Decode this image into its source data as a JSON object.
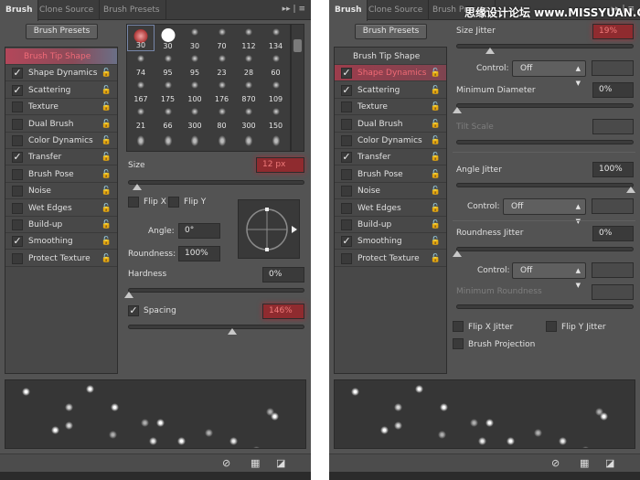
{
  "tabs": [
    "Brush",
    "Clone Source",
    "Brush Presets"
  ],
  "brush_presets_button": "Brush Presets",
  "watermark": "思缘设计论坛 www.MISSYUAN.COM",
  "left_panel": {
    "list": [
      {
        "label": "Brush Tip Shape",
        "checked": null,
        "highlight": true
      },
      {
        "label": "Shape Dynamics",
        "checked": true
      },
      {
        "label": "Scattering",
        "checked": true
      },
      {
        "label": "Texture",
        "checked": false
      },
      {
        "label": "Dual Brush",
        "checked": false
      },
      {
        "label": "Color Dynamics",
        "checked": false
      },
      {
        "label": "Transfer",
        "checked": true
      },
      {
        "label": "Brush Pose",
        "checked": false
      },
      {
        "label": "Noise",
        "checked": false
      },
      {
        "label": "Wet Edges",
        "checked": false
      },
      {
        "label": "Build-up",
        "checked": false
      },
      {
        "label": "Smoothing",
        "checked": true
      },
      {
        "label": "Protect Texture",
        "checked": false
      }
    ],
    "brush_sizes": [
      "30",
      "30",
      "30",
      "70",
      "112",
      "134",
      "74",
      "95",
      "95",
      "23",
      "28",
      "60",
      "167",
      "175",
      "100",
      "176",
      "870",
      "109",
      "21",
      "66",
      "300",
      "80",
      "300",
      "150"
    ],
    "size_label": "Size",
    "size_value": "12 px",
    "size_slider": 0.05,
    "flip_x": "Flip X",
    "flip_y": "Flip Y",
    "angle_label": "Angle:",
    "angle_value": "0°",
    "roundness_label": "Roundness:",
    "roundness_value": "100%",
    "hardness_label": "Hardness",
    "hardness_value": "0%",
    "hardness_slider": 0,
    "spacing_label": "Spacing",
    "spacing_checked": true,
    "spacing_value": "146%",
    "spacing_slider": 0.6
  },
  "right_panel": {
    "list": [
      {
        "label": "Brush Tip Shape",
        "checked": null
      },
      {
        "label": "Shape Dynamics",
        "checked": true,
        "highlight": true
      },
      {
        "label": "Scattering",
        "checked": true
      },
      {
        "label": "Texture",
        "checked": false
      },
      {
        "label": "Dual Brush",
        "checked": false
      },
      {
        "label": "Color Dynamics",
        "checked": false
      },
      {
        "label": "Transfer",
        "checked": true
      },
      {
        "label": "Brush Pose",
        "checked": false
      },
      {
        "label": "Noise",
        "checked": false
      },
      {
        "label": "Wet Edges",
        "checked": false
      },
      {
        "label": "Build-up",
        "checked": false
      },
      {
        "label": "Smoothing",
        "checked": true
      },
      {
        "label": "Protect Texture",
        "checked": false
      }
    ],
    "size_jitter_label": "Size Jitter",
    "size_jitter_value": "19%",
    "size_jitter_slider": 0.19,
    "control_label": "Control:",
    "control1_value": "Off",
    "min_diameter_label": "Minimum Diameter",
    "min_diameter_value": "0%",
    "tilt_scale_label": "Tilt Scale",
    "angle_jitter_label": "Angle Jitter",
    "angle_jitter_value": "100%",
    "angle_jitter_slider": 1.0,
    "control2_value": "Off",
    "roundness_jitter_label": "Roundness Jitter",
    "roundness_jitter_value": "0%",
    "roundness_jitter_slider": 0,
    "control3_value": "Off",
    "min_roundness_label": "Minimum Roundness",
    "flip_x_jitter": "Flip X Jitter",
    "flip_y_jitter": "Flip Y Jitter",
    "brush_projection": "Brush Projection"
  }
}
